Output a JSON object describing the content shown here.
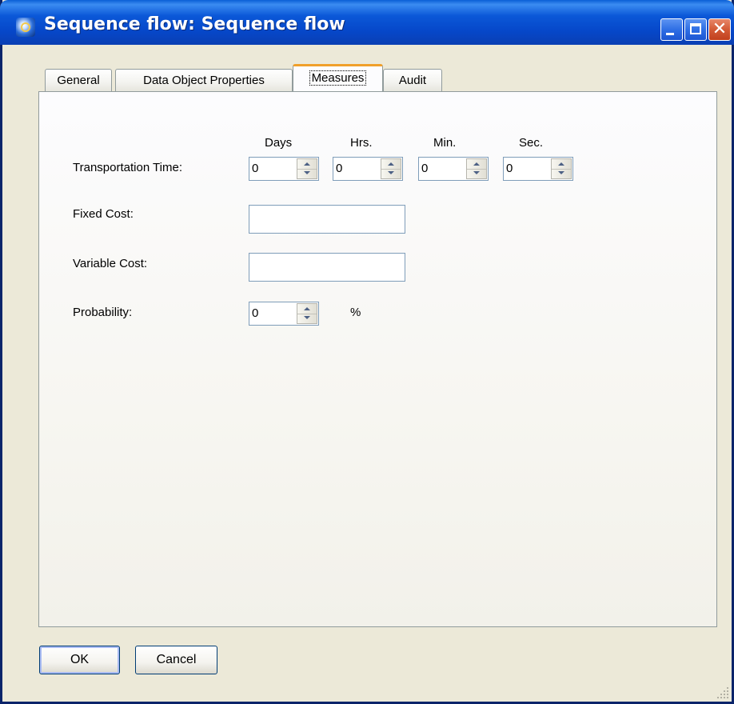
{
  "window": {
    "title": "Sequence flow: Sequence flow",
    "controls": {
      "minimize_icon": "minimize-icon",
      "maximize_icon": "maximize-icon",
      "close_icon": "close-icon",
      "close_glyph": "✕"
    }
  },
  "tabs": [
    {
      "label": "General",
      "active": false
    },
    {
      "label": "Data Object Properties",
      "active": false
    },
    {
      "label": "Measures",
      "active": true
    },
    {
      "label": "Audit",
      "active": false
    }
  ],
  "measures": {
    "transportation_time": {
      "label": "Transportation Time:",
      "columns": [
        "Days",
        "Hrs.",
        "Min.",
        "Sec."
      ],
      "values": [
        "0",
        "0",
        "0",
        "0"
      ]
    },
    "fixed_cost": {
      "label": "Fixed Cost:",
      "value": ""
    },
    "variable_cost": {
      "label": "Variable Cost:",
      "value": ""
    },
    "probability": {
      "label": "Probability:",
      "value": "0",
      "unit": "%"
    }
  },
  "buttons": {
    "ok": "OK",
    "cancel": "Cancel"
  },
  "colors": {
    "titlebar": "#0b58d8",
    "active_tab_accent": "#f0a02a",
    "dialog_bg": "#ece9d8"
  }
}
